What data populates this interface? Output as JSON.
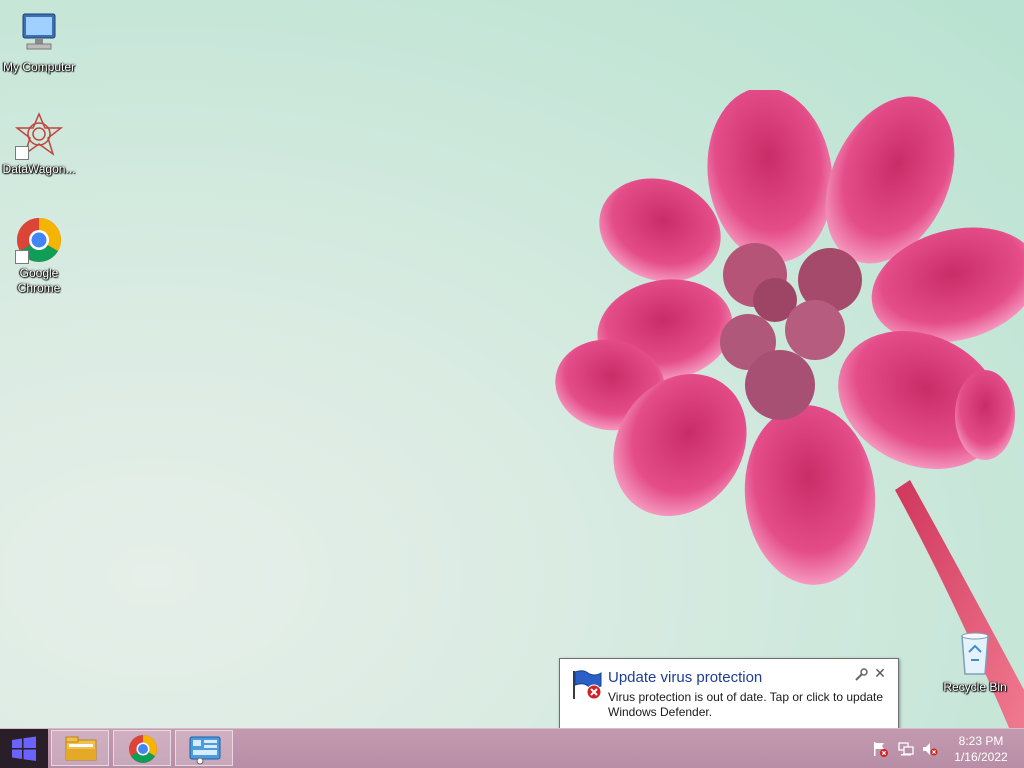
{
  "desktop": {
    "icons": [
      {
        "label": "My Computer",
        "icon": "computer-icon"
      },
      {
        "label": "DataWagon...",
        "icon": "datawagon-icon"
      },
      {
        "label": "Google Chrome",
        "icon": "chrome-icon"
      },
      {
        "label": "Recycle Bin",
        "icon": "recycle-bin-icon"
      }
    ]
  },
  "notification": {
    "title": "Update virus protection",
    "message": "Virus protection is out of date. Tap or click to update Windows Defender.",
    "icon": "defender-flag-error-icon",
    "options_icon": "wrench-icon",
    "close_icon": "close-icon",
    "close_glyph": "✕"
  },
  "taskbar": {
    "start_icon": "windows-logo-icon",
    "pinned": [
      {
        "name": "File Explorer",
        "icon": "file-explorer-icon"
      },
      {
        "name": "Google Chrome",
        "icon": "chrome-icon"
      },
      {
        "name": "Control Panel",
        "icon": "control-panel-icon"
      }
    ],
    "tray": [
      {
        "name": "Action Center",
        "icon": "action-center-flag-icon"
      },
      {
        "name": "Network",
        "icon": "network-icon"
      },
      {
        "name": "Volume",
        "icon": "volume-muted-icon"
      }
    ],
    "clock": {
      "time": "8:23 PM",
      "date": "1/16/2022"
    }
  },
  "colors": {
    "taskbar": "#b78ea6",
    "start_button": "#2a1f29",
    "windows_logo": "#6a63ff",
    "balloon_title": "#1c3e94",
    "flower": "#e0407e"
  }
}
